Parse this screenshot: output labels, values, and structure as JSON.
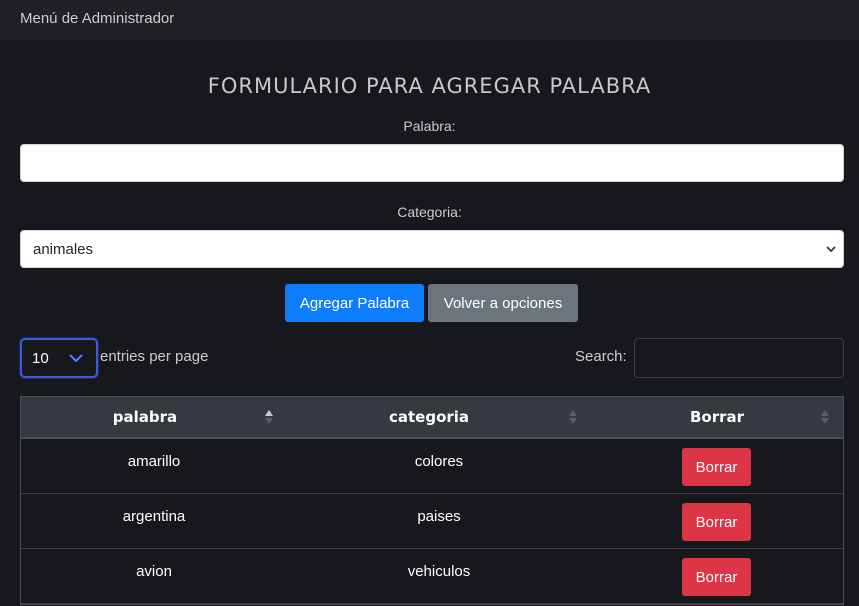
{
  "navbar": {
    "title": "Menú de Administrador"
  },
  "form": {
    "title": "FORMULARIO PARA AGREGAR PALABRA",
    "word_label": "Palabra:",
    "word_value": "",
    "category_label": "Categoria:",
    "category_selected": "animales",
    "add_button": "Agregar Palabra",
    "back_button": "Volver a opciones"
  },
  "datatable": {
    "page_length": "10",
    "entries_label": "entries per page",
    "search_label": "Search:",
    "search_value": "",
    "columns": [
      "palabra",
      "categoria",
      "Borrar"
    ],
    "rows": [
      {
        "palabra": "amarillo",
        "categoria": "colores",
        "action": "Borrar"
      },
      {
        "palabra": "argentina",
        "categoria": "paises",
        "action": "Borrar"
      },
      {
        "palabra": "avion",
        "categoria": "vehiculos",
        "action": "Borrar"
      }
    ]
  },
  "colors": {
    "primary": "#0d7dfb",
    "secondary": "#6c757d",
    "danger": "#dc3545",
    "background": "#16181d",
    "table_header": "#343a40"
  }
}
